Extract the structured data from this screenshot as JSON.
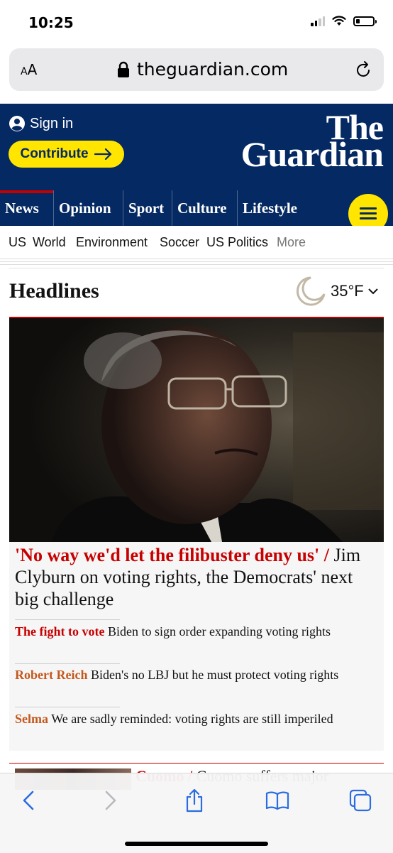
{
  "status_bar": {
    "time": "10:25"
  },
  "browser": {
    "text_size_label": "AA",
    "url": "theguardian.com"
  },
  "header": {
    "sign_in": "Sign in",
    "contribute": "Contribute",
    "logo_line1": "The",
    "logo_line2": "Guardian"
  },
  "pillars": [
    "News",
    "Opinion",
    "Sport",
    "Culture",
    "Lifestyle"
  ],
  "subnav": [
    "US",
    "World",
    "Environment",
    "Soccer",
    "US Politics",
    "More"
  ],
  "section": {
    "title": "Headlines",
    "temperature": "35°F"
  },
  "top_story": {
    "kicker": "'No way we'd let the filibuster deny us' /",
    "headline": "Jim Clyburn on voting rights, the Democrats' next big challenge"
  },
  "sublinks": [
    {
      "kicker": "The fight to vote",
      "text": "Biden to sign order expanding voting rights"
    },
    {
      "kicker": "Robert Reich",
      "text": "Biden's no LBJ but he must protect voting rights"
    },
    {
      "kicker": "Selma",
      "text": "We are sadly reminded: voting rights are still imperiled"
    }
  ],
  "next_story": {
    "kicker": "Cuomo /",
    "headline": "Cuomo suffers major"
  },
  "colors": {
    "guardian_blue": "#052962",
    "brand_yellow": "#ffe500",
    "news_red": "#c70000",
    "opinion_orange": "#c4581d"
  },
  "icons": [
    "user-icon",
    "arrow-right-icon",
    "lock-icon",
    "reload-icon",
    "moon-icon",
    "chevron-down-icon",
    "back-icon",
    "forward-icon",
    "share-icon",
    "bookmarks-icon",
    "tabs-icon"
  ]
}
